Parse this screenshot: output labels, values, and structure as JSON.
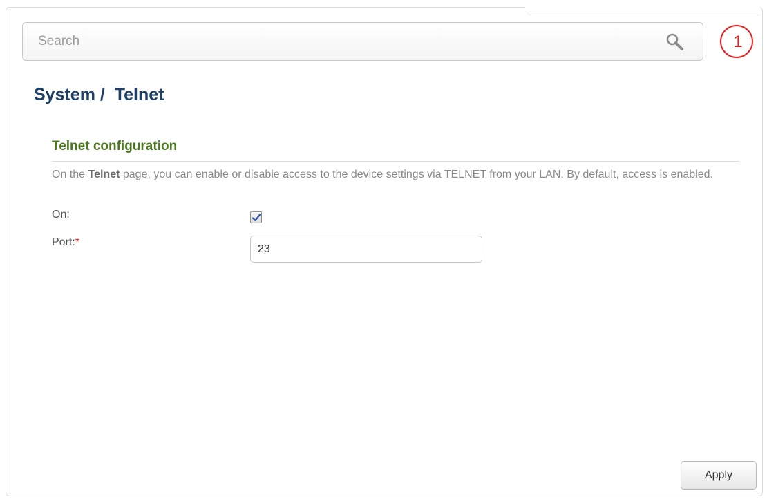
{
  "search": {
    "placeholder": "Search",
    "value": ""
  },
  "notifications": {
    "count": "1",
    "color": "#e02020"
  },
  "page": {
    "title": "System /  Telnet"
  },
  "section": {
    "title": "Telnet configuration",
    "description_prefix": "On the ",
    "description_bold": "Telnet",
    "description_suffix": " page, you can enable or disable access to the device settings via TELNET from your LAN. By default, access is enabled."
  },
  "fields": {
    "on_label": "On:",
    "on_checked": true,
    "port_label": "Port:",
    "port_required_mark": "*",
    "port_value": "23"
  },
  "actions": {
    "apply_label": "Apply"
  },
  "colors": {
    "title": "#1e3f66",
    "section_title": "#4b7a1e",
    "required": "#e02020"
  }
}
